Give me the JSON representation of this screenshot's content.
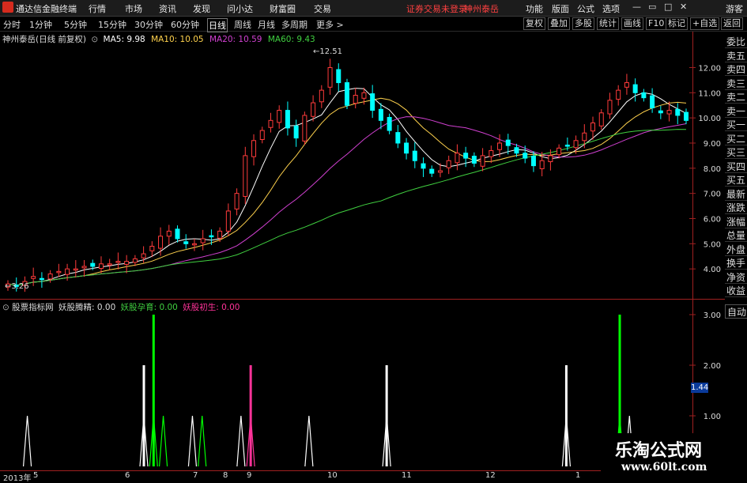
{
  "app": {
    "title": "通达信金融终端"
  },
  "menu": [
    "行情",
    "市场",
    "资讯",
    "发现",
    "问小达",
    "财富圈",
    "交易"
  ],
  "status": {
    "security": "证券交易未登录",
    "stock_name": "神州泰岳"
  },
  "right_menu": [
    "功能",
    "版面",
    "公式",
    "选项"
  ],
  "guest": "游客",
  "periods": [
    "分时",
    "1分钟",
    "5分钟",
    "15分钟",
    "30分钟",
    "60分钟",
    "日线",
    "周线",
    "月线",
    "多周期",
    "更多 >"
  ],
  "active_period": "日线",
  "tools": [
    "复权",
    "叠加",
    "多股",
    "统计",
    "画线",
    "F10",
    "标记",
    "+自选",
    "返回"
  ],
  "info": {
    "title": "神州泰岳(日线 前复权)",
    "ma5": "MA5: 9.98",
    "ma10": "MA10: 10.05",
    "ma20": "MA20: 10.59",
    "ma60": "MA60: 9.43"
  },
  "colors": {
    "ma5": "#ffffff",
    "ma10": "#ffd24d",
    "ma20": "#d040d0",
    "ma60": "#40d040",
    "up": "#ff3b3b",
    "down": "#00ffff"
  },
  "main_chart": {
    "y_ticks": [
      "12.00",
      "11.00",
      "10.00",
      "9.00",
      "8.00",
      "7.00",
      "6.00",
      "5.00",
      "4.00"
    ],
    "high_label": "12.51",
    "low_label": "3.26"
  },
  "right_tabs": [
    "委比",
    "卖五",
    "卖四",
    "卖三",
    "卖二",
    "卖一",
    "买一",
    "买二",
    "买三",
    "买四",
    "买五",
    "最新",
    "涨跌",
    "涨幅",
    "总量",
    "外盘",
    "换手",
    "净资",
    "收益"
  ],
  "auto_tab": "自动",
  "sub": {
    "title": "股票指标网",
    "l1": "妖股腾精: 0.00",
    "l2": "妖股孕育: 0.00",
    "l3": "妖股初生: 0.00",
    "y_ticks": [
      "3.00",
      "2.00",
      "1.00"
    ],
    "value_box": "1.44"
  },
  "x_axis": [
    "2013年",
    "5",
    "6",
    "7",
    "8",
    "9",
    "10",
    "11",
    "12",
    "1"
  ],
  "watermark": {
    "line1": "乐淘公式网",
    "line2": "www.60lt.com"
  },
  "chart_data": {
    "type": "line",
    "candles_close": [
      3.4,
      3.3,
      3.5,
      3.7,
      3.6,
      3.8,
      3.9,
      4.0,
      4.0,
      4.1,
      4.1,
      4.2,
      4.2,
      4.3,
      4.3,
      4.4,
      4.6,
      4.9,
      5.3,
      5.5,
      5.2,
      5.0,
      5.0,
      5.2,
      5.3,
      5.5,
      6.3,
      7.0,
      8.5,
      9.1,
      9.5,
      9.9,
      10.3,
      9.6,
      9.2,
      10.1,
      10.6,
      11.1,
      12.0,
      11.4,
      10.5,
      10.9,
      11.0,
      10.3,
      9.9,
      9.5,
      9.0,
      8.6,
      8.3,
      8.0,
      7.8,
      7.9,
      8.3,
      8.6,
      8.4,
      8.2,
      8.5,
      8.7,
      9.0,
      8.9,
      8.6,
      8.4,
      8.1,
      8.3,
      8.5,
      8.8,
      8.9,
      9.1,
      9.4,
      9.8,
      10.2,
      10.7,
      11.1,
      11.4,
      11.0,
      10.8,
      10.4,
      10.2,
      10.3,
      10.1,
      9.9
    ],
    "series": [
      {
        "name": "MA5",
        "values": [
          9.98
        ]
      },
      {
        "name": "MA10",
        "values": [
          10.05
        ]
      },
      {
        "name": "MA20",
        "values": [
          10.59
        ]
      },
      {
        "name": "MA60",
        "values": [
          9.43
        ]
      }
    ],
    "ylim": [
      3.0,
      12.8
    ],
    "signals": [
      {
        "x": 4,
        "color": "#ffffff",
        "v": 1.0
      },
      {
        "x": 28,
        "color": "#ffffff",
        "v": 2.0
      },
      {
        "x": 30,
        "color": "#00ff00",
        "v": 3.0
      },
      {
        "x": 32,
        "color": "#00ff00",
        "v": 1.0
      },
      {
        "x": 38,
        "color": "#ffffff",
        "v": 1.0
      },
      {
        "x": 40,
        "color": "#00ff00",
        "v": 1.0
      },
      {
        "x": 48,
        "color": "#ffffff",
        "v": 1.0
      },
      {
        "x": 50,
        "color": "#ff3399",
        "v": 2.0
      },
      {
        "x": 62,
        "color": "#ffffff",
        "v": 1.0
      },
      {
        "x": 78,
        "color": "#ffffff",
        "v": 2.0
      },
      {
        "x": 115,
        "color": "#ffffff",
        "v": 2.0
      },
      {
        "x": 126,
        "color": "#00ff00",
        "v": 3.0
      },
      {
        "x": 128,
        "color": "#ffffff",
        "v": 1.0
      }
    ]
  }
}
